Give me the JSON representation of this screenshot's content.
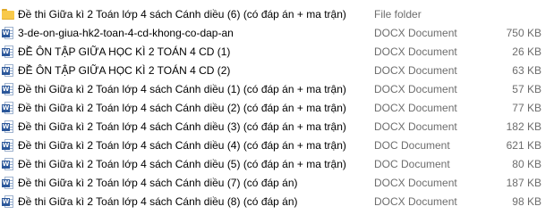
{
  "colors": {
    "folder": "#f8c94a",
    "word_blue": "#2b579a",
    "secondary_text": "#6d6d6d"
  },
  "icons": {
    "folder": "folder-icon",
    "word": "word-document-icon",
    "word_badge": "W"
  },
  "files": [
    {
      "name": "Đề thi Giữa kì 2 Toán lớp 4 sách Cánh diều (6) (có đáp án + ma trận)",
      "type": "File folder",
      "size": "",
      "icon": "folder"
    },
    {
      "name": "3-de-on-giua-hk2-toan-4-cd-khong-co-dap-an",
      "type": "DOCX Document",
      "size": "750 KB",
      "icon": "word"
    },
    {
      "name": "ĐỀ ÔN TẬP GIỮA HỌC KÌ 2 TOÁN 4 CD (1)",
      "type": "DOCX Document",
      "size": "26 KB",
      "icon": "word"
    },
    {
      "name": "ĐỀ ÔN TẬP GIỮA HỌC KÌ 2 TOÁN 4 CD (2)",
      "type": "DOCX Document",
      "size": "63 KB",
      "icon": "word"
    },
    {
      "name": "Đề thi Giữa kì 2 Toán lớp 4 sách Cánh diều (1) (có đáp án + ma trận)",
      "type": "DOCX Document",
      "size": "57 KB",
      "icon": "word"
    },
    {
      "name": "Đề thi Giữa kì 2 Toán lớp 4 sách Cánh diều (2) (có đáp án + ma trận)",
      "type": "DOCX Document",
      "size": "77 KB",
      "icon": "word"
    },
    {
      "name": "Đề thi Giữa kì 2 Toán lớp 4 sách Cánh diều (3) (có đáp án + ma trận)",
      "type": "DOCX Document",
      "size": "182 KB",
      "icon": "word"
    },
    {
      "name": "Đề thi Giữa kì 2 Toán lớp 4 sách Cánh diều (4) (có đáp án + ma trận)",
      "type": "DOC Document",
      "size": "621 KB",
      "icon": "word"
    },
    {
      "name": "Đề thi Giữa kì 2 Toán lớp 4 sách Cánh diều (5) (có đáp án + ma trận)",
      "type": "DOC Document",
      "size": "80 KB",
      "icon": "word"
    },
    {
      "name": "Đề thi Giữa kì 2 Toán lớp 4 sách Cánh diều (7) (có đáp án)",
      "type": "DOCX Document",
      "size": "187 KB",
      "icon": "word"
    },
    {
      "name": "Đề thi Giữa kì 2 Toán lớp 4 sách Cánh diều (8) (có đáp án)",
      "type": "DOCX Document",
      "size": "98 KB",
      "icon": "word"
    }
  ]
}
